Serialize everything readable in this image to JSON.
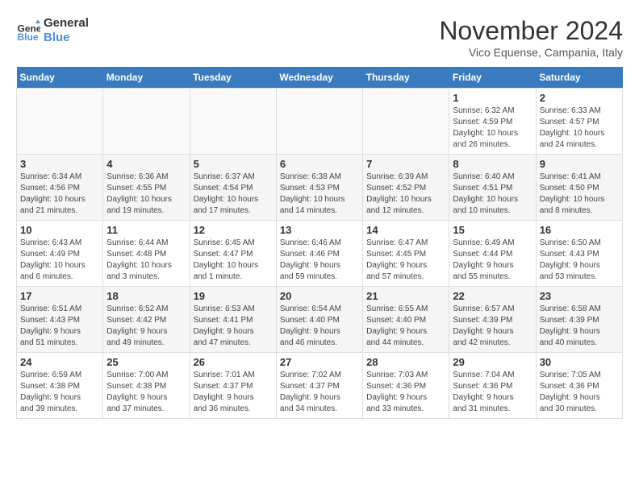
{
  "header": {
    "logo_line1": "General",
    "logo_line2": "Blue",
    "month_title": "November 2024",
    "location": "Vico Equense, Campania, Italy"
  },
  "weekdays": [
    "Sunday",
    "Monday",
    "Tuesday",
    "Wednesday",
    "Thursday",
    "Friday",
    "Saturday"
  ],
  "weeks": [
    [
      {
        "day": "",
        "detail": ""
      },
      {
        "day": "",
        "detail": ""
      },
      {
        "day": "",
        "detail": ""
      },
      {
        "day": "",
        "detail": ""
      },
      {
        "day": "",
        "detail": ""
      },
      {
        "day": "1",
        "detail": "Sunrise: 6:32 AM\nSunset: 4:59 PM\nDaylight: 10 hours\nand 26 minutes."
      },
      {
        "day": "2",
        "detail": "Sunrise: 6:33 AM\nSunset: 4:57 PM\nDaylight: 10 hours\nand 24 minutes."
      }
    ],
    [
      {
        "day": "3",
        "detail": "Sunrise: 6:34 AM\nSunset: 4:56 PM\nDaylight: 10 hours\nand 21 minutes."
      },
      {
        "day": "4",
        "detail": "Sunrise: 6:36 AM\nSunset: 4:55 PM\nDaylight: 10 hours\nand 19 minutes."
      },
      {
        "day": "5",
        "detail": "Sunrise: 6:37 AM\nSunset: 4:54 PM\nDaylight: 10 hours\nand 17 minutes."
      },
      {
        "day": "6",
        "detail": "Sunrise: 6:38 AM\nSunset: 4:53 PM\nDaylight: 10 hours\nand 14 minutes."
      },
      {
        "day": "7",
        "detail": "Sunrise: 6:39 AM\nSunset: 4:52 PM\nDaylight: 10 hours\nand 12 minutes."
      },
      {
        "day": "8",
        "detail": "Sunrise: 6:40 AM\nSunset: 4:51 PM\nDaylight: 10 hours\nand 10 minutes."
      },
      {
        "day": "9",
        "detail": "Sunrise: 6:41 AM\nSunset: 4:50 PM\nDaylight: 10 hours\nand 8 minutes."
      }
    ],
    [
      {
        "day": "10",
        "detail": "Sunrise: 6:43 AM\nSunset: 4:49 PM\nDaylight: 10 hours\nand 6 minutes."
      },
      {
        "day": "11",
        "detail": "Sunrise: 6:44 AM\nSunset: 4:48 PM\nDaylight: 10 hours\nand 3 minutes."
      },
      {
        "day": "12",
        "detail": "Sunrise: 6:45 AM\nSunset: 4:47 PM\nDaylight: 10 hours\nand 1 minute."
      },
      {
        "day": "13",
        "detail": "Sunrise: 6:46 AM\nSunset: 4:46 PM\nDaylight: 9 hours\nand 59 minutes."
      },
      {
        "day": "14",
        "detail": "Sunrise: 6:47 AM\nSunset: 4:45 PM\nDaylight: 9 hours\nand 57 minutes."
      },
      {
        "day": "15",
        "detail": "Sunrise: 6:49 AM\nSunset: 4:44 PM\nDaylight: 9 hours\nand 55 minutes."
      },
      {
        "day": "16",
        "detail": "Sunrise: 6:50 AM\nSunset: 4:43 PM\nDaylight: 9 hours\nand 53 minutes."
      }
    ],
    [
      {
        "day": "17",
        "detail": "Sunrise: 6:51 AM\nSunset: 4:43 PM\nDaylight: 9 hours\nand 51 minutes."
      },
      {
        "day": "18",
        "detail": "Sunrise: 6:52 AM\nSunset: 4:42 PM\nDaylight: 9 hours\nand 49 minutes."
      },
      {
        "day": "19",
        "detail": "Sunrise: 6:53 AM\nSunset: 4:41 PM\nDaylight: 9 hours\nand 47 minutes."
      },
      {
        "day": "20",
        "detail": "Sunrise: 6:54 AM\nSunset: 4:40 PM\nDaylight: 9 hours\nand 46 minutes."
      },
      {
        "day": "21",
        "detail": "Sunrise: 6:55 AM\nSunset: 4:40 PM\nDaylight: 9 hours\nand 44 minutes."
      },
      {
        "day": "22",
        "detail": "Sunrise: 6:57 AM\nSunset: 4:39 PM\nDaylight: 9 hours\nand 42 minutes."
      },
      {
        "day": "23",
        "detail": "Sunrise: 6:58 AM\nSunset: 4:39 PM\nDaylight: 9 hours\nand 40 minutes."
      }
    ],
    [
      {
        "day": "24",
        "detail": "Sunrise: 6:59 AM\nSunset: 4:38 PM\nDaylight: 9 hours\nand 39 minutes."
      },
      {
        "day": "25",
        "detail": "Sunrise: 7:00 AM\nSunset: 4:38 PM\nDaylight: 9 hours\nand 37 minutes."
      },
      {
        "day": "26",
        "detail": "Sunrise: 7:01 AM\nSunset: 4:37 PM\nDaylight: 9 hours\nand 36 minutes."
      },
      {
        "day": "27",
        "detail": "Sunrise: 7:02 AM\nSunset: 4:37 PM\nDaylight: 9 hours\nand 34 minutes."
      },
      {
        "day": "28",
        "detail": "Sunrise: 7:03 AM\nSunset: 4:36 PM\nDaylight: 9 hours\nand 33 minutes."
      },
      {
        "day": "29",
        "detail": "Sunrise: 7:04 AM\nSunset: 4:36 PM\nDaylight: 9 hours\nand 31 minutes."
      },
      {
        "day": "30",
        "detail": "Sunrise: 7:05 AM\nSunset: 4:36 PM\nDaylight: 9 hours\nand 30 minutes."
      }
    ]
  ]
}
